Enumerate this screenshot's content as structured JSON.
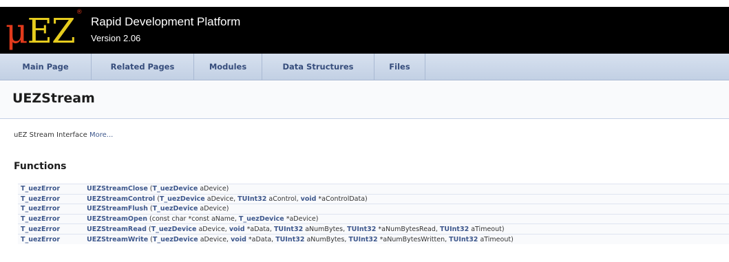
{
  "header": {
    "logo_mu": "μ",
    "logo_ez": "EZ",
    "logo_reg": "®",
    "project_title": "Rapid Development Platform",
    "project_version": "Version 2.06"
  },
  "tabs": [
    {
      "label": "Main Page"
    },
    {
      "label": "Related Pages"
    },
    {
      "label": "Modules"
    },
    {
      "label": "Data Structures"
    },
    {
      "label": "Files"
    }
  ],
  "page": {
    "title": "UEZStream",
    "brief_text": "uEZ Stream Interface",
    "more_link": "More..."
  },
  "functions": {
    "heading": "Functions",
    "rows": [
      {
        "return_type": "T_uezError",
        "parts": [
          {
            "t": "UEZStreamClose",
            "link": true
          },
          {
            "t": " (",
            "link": false
          },
          {
            "t": "T_uezDevice",
            "link": true
          },
          {
            "t": " aDevice)",
            "link": false
          }
        ]
      },
      {
        "return_type": "T_uezError",
        "parts": [
          {
            "t": "UEZStreamControl",
            "link": true
          },
          {
            "t": " (",
            "link": false
          },
          {
            "t": "T_uezDevice",
            "link": true
          },
          {
            "t": " aDevice, ",
            "link": false
          },
          {
            "t": "TUInt32",
            "link": true
          },
          {
            "t": " aControl, ",
            "link": false
          },
          {
            "t": "void",
            "link": true
          },
          {
            "t": " *aControlData)",
            "link": false
          }
        ]
      },
      {
        "return_type": "T_uezError",
        "parts": [
          {
            "t": "UEZStreamFlush",
            "link": true
          },
          {
            "t": " (",
            "link": false
          },
          {
            "t": "T_uezDevice",
            "link": true
          },
          {
            "t": " aDevice)",
            "link": false
          }
        ]
      },
      {
        "return_type": "T_uezError",
        "parts": [
          {
            "t": "UEZStreamOpen",
            "link": true
          },
          {
            "t": " (const char *const aName, ",
            "link": false
          },
          {
            "t": "T_uezDevice",
            "link": true
          },
          {
            "t": " *aDevice)",
            "link": false
          }
        ]
      },
      {
        "return_type": "T_uezError",
        "parts": [
          {
            "t": "UEZStreamRead",
            "link": true
          },
          {
            "t": " (",
            "link": false
          },
          {
            "t": "T_uezDevice",
            "link": true
          },
          {
            "t": " aDevice, ",
            "link": false
          },
          {
            "t": "void",
            "link": true
          },
          {
            "t": " *aData, ",
            "link": false
          },
          {
            "t": "TUInt32",
            "link": true
          },
          {
            "t": " aNumBytes, ",
            "link": false
          },
          {
            "t": "TUInt32",
            "link": true
          },
          {
            "t": " *aNumBytesRead, ",
            "link": false
          },
          {
            "t": "TUInt32",
            "link": true
          },
          {
            "t": " aTimeout)",
            "link": false
          }
        ]
      },
      {
        "return_type": "T_uezError",
        "parts": [
          {
            "t": "UEZStreamWrite",
            "link": true
          },
          {
            "t": " (",
            "link": false
          },
          {
            "t": "T_uezDevice",
            "link": true
          },
          {
            "t": " aDevice, ",
            "link": false
          },
          {
            "t": "void",
            "link": true
          },
          {
            "t": " *aData, ",
            "link": false
          },
          {
            "t": "TUInt32",
            "link": true
          },
          {
            "t": " aNumBytes, ",
            "link": false
          },
          {
            "t": "TUInt32",
            "link": true
          },
          {
            "t": " *aNumBytesWritten, ",
            "link": false
          },
          {
            "t": "TUInt32",
            "link": true
          },
          {
            "t": " aTimeout)",
            "link": false
          }
        ]
      }
    ]
  },
  "colors": {
    "link": "#3d578c",
    "header_bg": "#000000",
    "logo_mu": "#e23a1c",
    "logo_ez": "#e6cc1e",
    "tab_text": "#364d7c"
  }
}
